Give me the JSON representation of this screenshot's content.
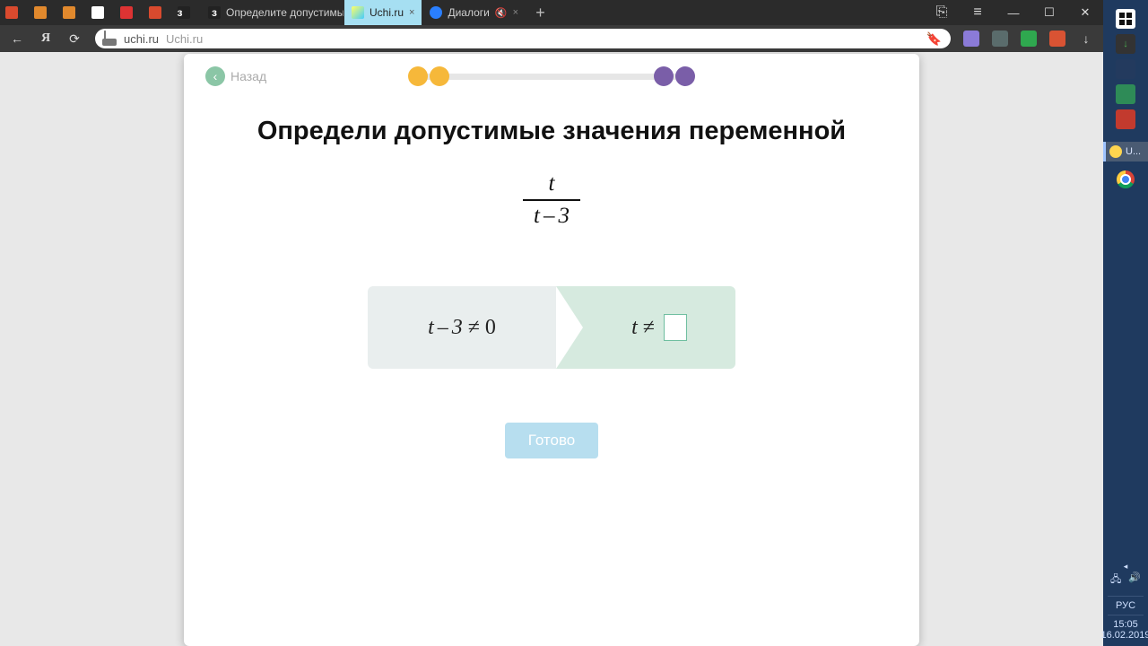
{
  "chrome": {
    "tabs": [
      {
        "title": ""
      },
      {
        "title": ""
      },
      {
        "title": ""
      },
      {
        "title": ""
      },
      {
        "title": ""
      },
      {
        "title": ""
      },
      {
        "title": ""
      },
      {
        "title": "Определите допустимые з"
      },
      {
        "title": "Uchi.ru",
        "active": true
      },
      {
        "title": "Диалоги",
        "muted": true
      }
    ],
    "url_host": "uchi.ru",
    "url_path": "Uchi.ru"
  },
  "gutter": {
    "pin_label": "U...",
    "lang": "РУС",
    "time": "15:05",
    "date": "16.02.2019"
  },
  "page": {
    "back_label": "Назад",
    "title": "Определи допустимые значения переменной",
    "fraction": {
      "numerator": "t",
      "denominator_left": "t",
      "denominator_op": "–",
      "denominator_right": "3"
    },
    "step1": {
      "lhs_l": "t",
      "lhs_op": "–",
      "lhs_r": "3",
      "rel": "≠",
      "rhs": "0"
    },
    "step2": {
      "lhs": "t",
      "rel": "≠",
      "answer": ""
    },
    "ready_label": "Готово"
  }
}
